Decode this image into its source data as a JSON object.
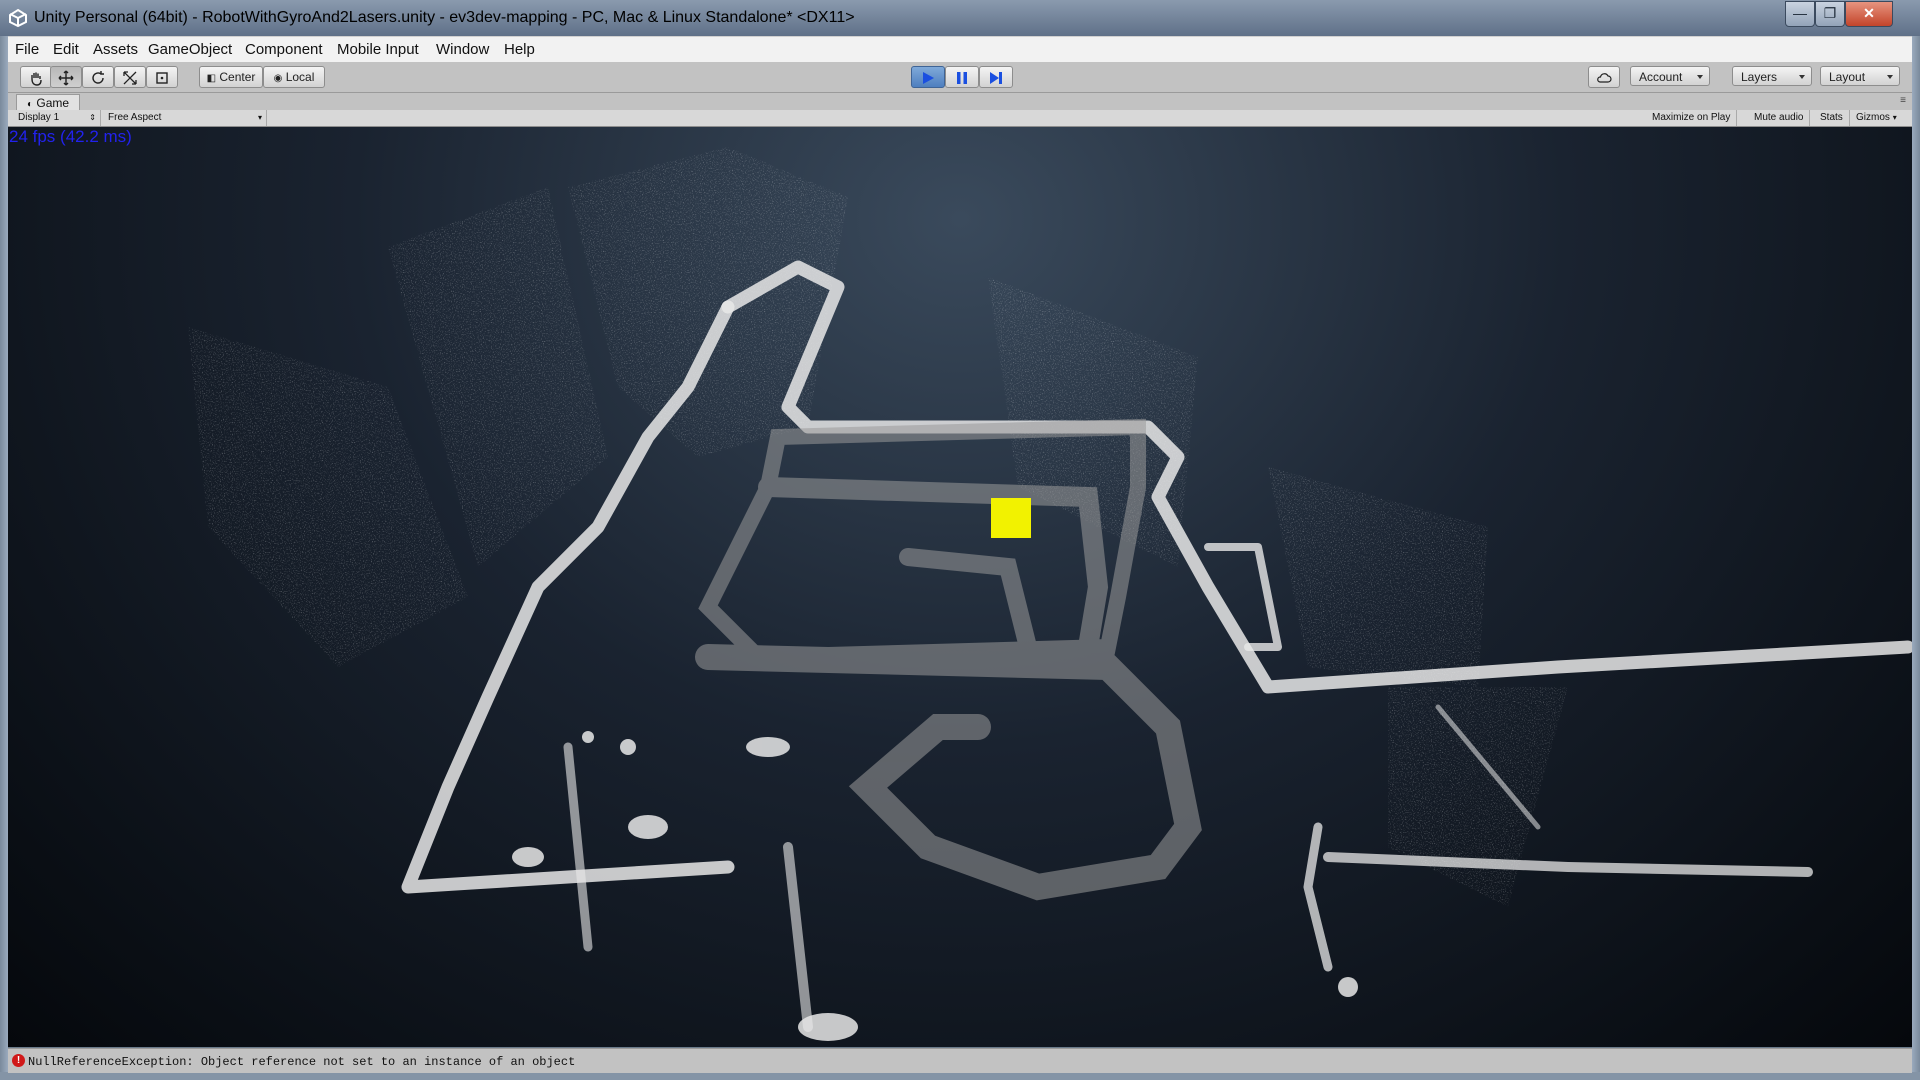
{
  "window": {
    "title": "Unity Personal (64bit) - RobotWithGyroAnd2Lasers.unity - ev3dev-mapping - PC, Mac & Linux Standalone* <DX11>",
    "controls": {
      "minimize": "—",
      "maximize": "❐",
      "close": "✕"
    }
  },
  "menu": [
    {
      "label": "File"
    },
    {
      "label": "Edit"
    },
    {
      "label": "Assets"
    },
    {
      "label": "GameObject"
    },
    {
      "label": "Component"
    },
    {
      "label": "Mobile Input"
    },
    {
      "label": "Window"
    },
    {
      "label": "Help"
    }
  ],
  "toolbar": {
    "tools": [
      "hand-icon",
      "move-icon",
      "rotate-icon",
      "scale-icon",
      "rect-icon"
    ],
    "pivot": "Center",
    "space": "Local",
    "play_state": "playing",
    "account": "Account",
    "layers": "Layers",
    "layout": "Layout"
  },
  "game_view": {
    "tab": "Game",
    "display": "Display 1",
    "aspect": "Free Aspect",
    "options": {
      "maximize": "Maximize on Play",
      "mute": "Mute audio",
      "stats": "Stats",
      "gizmos": "Gizmos"
    },
    "fps": "24 fps (42.2 ms)",
    "marker_color": "#f2f200"
  },
  "status": {
    "message": "NullReferenceException: Object reference not set to an instance of an object"
  },
  "colors": {
    "play_accent": "#4e7fbf",
    "error": "#d01818",
    "fps_text": "#2222ee"
  }
}
